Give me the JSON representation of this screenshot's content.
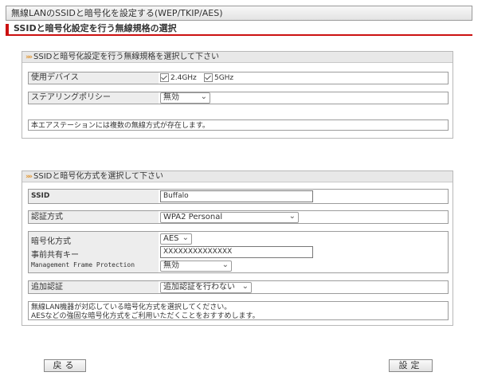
{
  "page": {
    "title": "無線LANのSSIDと暗号化を設定する(WEP/TKIP/AES)",
    "section_title": "SSIDと暗号化設定を行う無線規格の選択"
  },
  "standard_panel": {
    "header": "SSIDと暗号化設定を行う無線規格を選択して下さい",
    "device_label": "使用デバイス",
    "band_24": "2.4GHz",
    "band_5": "5GHz",
    "steering_label": "ステアリングポリシー",
    "steering_value": "無効",
    "note": "本エアステーションには複数の無線方式が存在します。"
  },
  "crypto_panel": {
    "header": "SSIDと暗号化方式を選択して下さい",
    "ssid_label": "SSID",
    "ssid_value": "Buffalo",
    "auth_label": "認証方式",
    "auth_value": "WPA2 Personal",
    "enc_label": "暗号化方式",
    "enc_value": "AES",
    "psk_label": "事前共有キー",
    "psk_value": "XXXXXXXXXXXXXX",
    "mfp_label": "Management Frame Protection",
    "mfp_value": "無効",
    "extra_auth_label": "追加認証",
    "extra_auth_value": "追加認証を行わない",
    "note_line1": "無線LAN機器が対応している暗号化方式を選択してください。",
    "note_line2": "AESなどの強固な暗号化方式をご利用いただくことをおすすめします。"
  },
  "buttons": {
    "back": "戻る",
    "apply": "設定"
  },
  "colors": {
    "accent_red": "#cc1111",
    "header_icon_orange": "#e08b1a"
  }
}
